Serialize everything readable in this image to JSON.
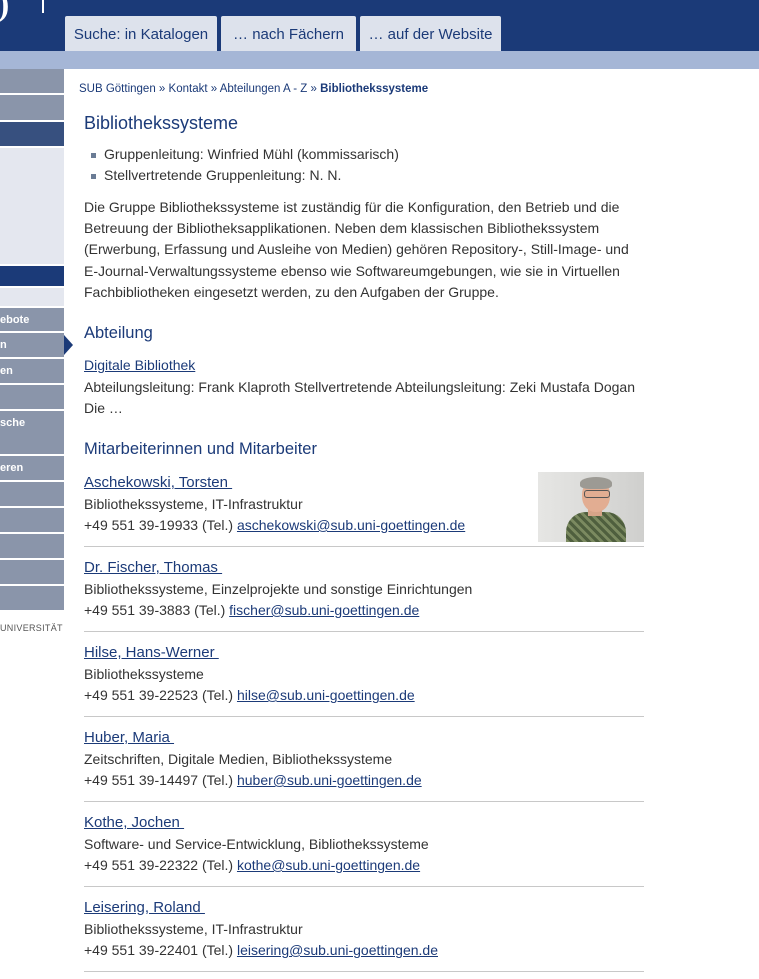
{
  "header": {
    "logo_glyph": ")",
    "tabs": [
      "Suche: in Katalogen",
      "… nach Fächern",
      "… auf der Website"
    ]
  },
  "sidebar": {
    "labels": [
      "ebote",
      "n",
      "en",
      "sche",
      "eren"
    ],
    "university_text": "UNIVERSITÄT"
  },
  "breadcrumb": {
    "items": [
      "SUB Göttingen",
      "Kontakt",
      "Abteilungen A - Z"
    ],
    "separator": "»",
    "current": "Bibliothekssysteme"
  },
  "page": {
    "title": "Bibliothekssysteme",
    "leaders": [
      "Gruppenleitung: Winfried Mühl (kommissarisch)",
      "Stellvertretende Gruppenleitung: N. N."
    ],
    "description": "Die Gruppe Bibliothekssysteme ist zuständig für die Konfiguration, den Betrieb und die Betreuung der Bibliotheksapplikationen. Neben dem klassischen Bibliothekssystem (Erwerbung, Erfassung und Ausleihe von Medien) gehören Repository-, Still-Image- und E-Journal-Verwaltungssysteme ebenso wie Softwareumgebungen, wie sie in Virtuellen Fachbibliotheken eingesetzt werden, zu den Aufgaben der Gruppe."
  },
  "department": {
    "heading": "Abteilung",
    "link": "Digitale Bibliothek",
    "text": "Abteilungsleitung: Frank Klaproth  Stellvertretende Abteilungsleitung: Zeki Mustafa Dogan Die …"
  },
  "staff": {
    "heading": "Mitarbeiterinnen und Mitarbeiter",
    "tel_suffix": "(Tel.)",
    "people": [
      {
        "name": "Aschekowski, Torsten ",
        "dept": "Bibliothekssysteme, IT-Infrastruktur",
        "phone": "+49 551 39-19933",
        "email": "aschekowski@sub.uni-goettingen.de"
      },
      {
        "name": "Dr. Fischer, Thomas ",
        "dept": "Bibliothekssysteme, Einzelprojekte und sonstige Einrichtungen",
        "phone": "+49 551 39-3883",
        "email": "fischer@sub.uni-goettingen.de"
      },
      {
        "name": "Hilse, Hans-Werner ",
        "dept": "Bibliothekssysteme",
        "phone": "+49 551 39-22523",
        "email": "hilse@sub.uni-goettingen.de"
      },
      {
        "name": "Huber, Maria ",
        "dept": "Zeitschriften, Digitale Medien, Bibliothekssysteme",
        "phone": "+49 551 39-14497",
        "email": "huber@sub.uni-goettingen.de"
      },
      {
        "name": "Kothe, Jochen ",
        "dept": "Software- und Service-Entwicklung, Bibliothekssysteme",
        "phone": "+49 551 39-22322",
        "email": "kothe@sub.uni-goettingen.de"
      },
      {
        "name": "Leisering, Roland ",
        "dept": "Bibliothekssysteme, IT-Infrastruktur",
        "phone": "+49 551 39-22401",
        "email": "leisering@sub.uni-goettingen.de"
      }
    ]
  }
}
